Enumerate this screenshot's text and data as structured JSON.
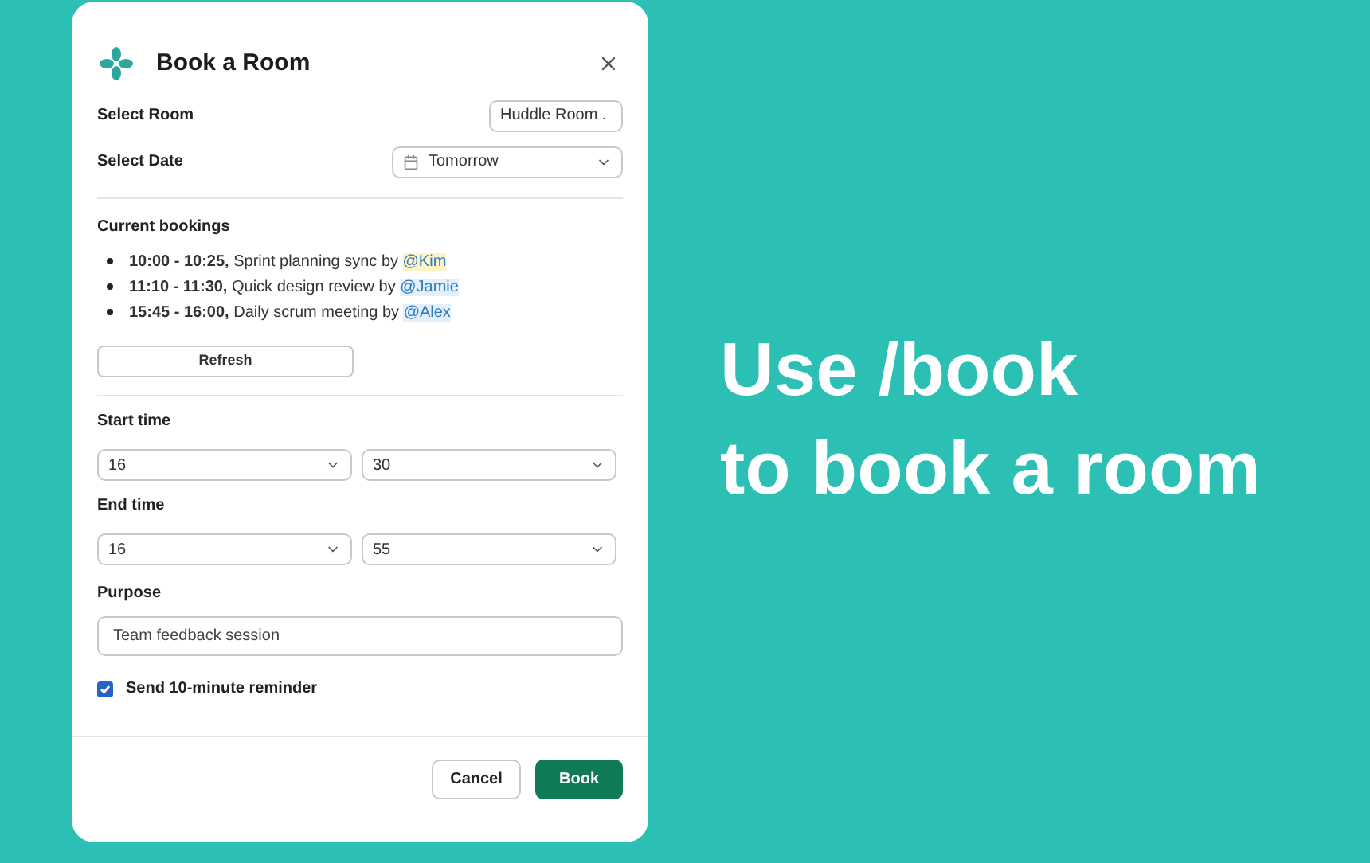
{
  "dialog": {
    "title": "Book a Room",
    "fields": [
      {
        "label": "Select Room",
        "kind": "select",
        "value": "Huddle Room ."
      },
      {
        "label": "Select Date",
        "kind": "date",
        "value": "Tomorrow"
      }
    ],
    "bookings_title": "Current bookings",
    "bookings": [
      {
        "text": "**10:00 - 10:25,** Sprint planning sync by",
        "mention": "@Kim",
        "color": "#fdf3c4"
      },
      {
        "text": "**11:10 - 11:30,** Quick design review by",
        "mention": "@Jamie",
        "color": "#e3effa"
      },
      {
        "text": "**15:45 - 16:00,** Daily scrum meeting by",
        "mention": "@Alex",
        "color": "#e3effa"
      }
    ],
    "refresh": "Refresh",
    "times": [
      {
        "label": "Start time",
        "hour": "16",
        "minute": "30"
      },
      {
        "label": "End time",
        "hour": "16",
        "minute": "55"
      }
    ],
    "purpose": {
      "label": "Purpose",
      "value": "Team feedback session"
    },
    "reminder": {
      "label": "Send 10-minute reminder",
      "checked": true
    },
    "buttons": [
      {
        "label": "Cancel",
        "kind": "secondary"
      },
      {
        "label": "Book",
        "kind": "primary"
      }
    ]
  },
  "headline": [
    "Use /book",
    "to book a room"
  ]
}
